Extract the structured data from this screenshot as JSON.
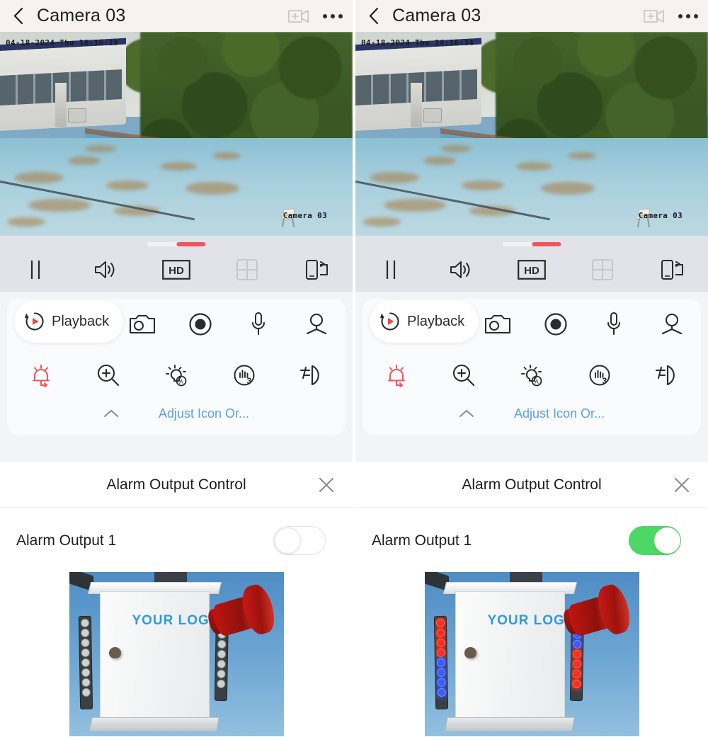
{
  "app": {
    "header": {
      "back_icon": "back-chevron-icon",
      "title": "Camera 03",
      "add_camera_icon": "add-camera-icon",
      "more_icon": "more-options-icon"
    },
    "video": {
      "watermark": "Camera 03",
      "left_timestamp": "04-18-2024 Thu 10:16:19",
      "right_timestamp": "04-18-2024 Thu 10:16:34"
    },
    "control_bar": {
      "progress_track_color": "#f2f2f4",
      "progress_fill_color": "#f0565c",
      "buttons": [
        {
          "name": "pause-button",
          "icon": "pause-icon",
          "label": "Pause"
        },
        {
          "name": "volume-button",
          "icon": "speaker-icon",
          "label": "Volume"
        },
        {
          "name": "quality-button",
          "icon": "hd-icon",
          "label": "HD"
        },
        {
          "name": "multiscreen-button",
          "icon": "grid-four-icon",
          "label": "Multi-screen"
        },
        {
          "name": "rotate-button",
          "icon": "rotate-screen-icon",
          "label": "Rotate"
        }
      ]
    },
    "toolbar": {
      "playback_label": "Playback",
      "playback_icon": "playback-replay-icon",
      "row1": [
        {
          "name": "snapshot-button",
          "icon": "camera-icon",
          "label": "Snapshot"
        },
        {
          "name": "record-button",
          "icon": "record-dot-icon",
          "label": "Record"
        },
        {
          "name": "two-way-audio-button",
          "icon": "microphone-icon",
          "label": "Two-way Audio"
        },
        {
          "name": "ptz-button",
          "icon": "ptz-icon",
          "label": "PTZ"
        }
      ],
      "row2": [
        {
          "name": "alarm-output-button",
          "icon": "alarm-output-icon",
          "label": "Alarm Output",
          "active": true,
          "color": "#f0565c"
        },
        {
          "name": "digital-zoom-button",
          "icon": "zoom-in-icon",
          "label": "Digital Zoom"
        },
        {
          "name": "smart-light-button",
          "icon": "smart-light-auto-icon",
          "label": "Smart Light"
        },
        {
          "name": "audio-alarm-button",
          "icon": "audio-alarm-3-icon",
          "label": "Audio Alarm"
        },
        {
          "name": "flood-light-button",
          "icon": "flood-light-icon",
          "label": "Flood Light"
        }
      ],
      "collapse_icon": "chevron-up-icon",
      "adjust_link": "Adjust Icon Or..."
    },
    "alarm_sheet": {
      "title": "Alarm Output Control",
      "close_icon": "close-icon",
      "item_label": "Alarm Output 1",
      "left_toggle_state": "off",
      "right_toggle_state": "on",
      "toggle_on_color": "#4cd864"
    },
    "product_image": {
      "logo_text": "YOUR LOGO",
      "left_leds": "off",
      "right_leds": "on"
    }
  }
}
